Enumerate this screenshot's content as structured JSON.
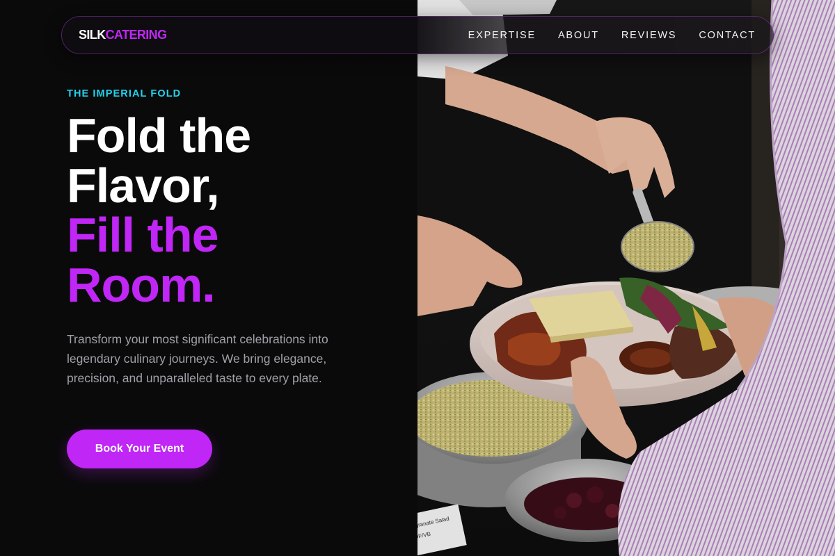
{
  "brand": {
    "part1": "SILK",
    "part2": "CATERING"
  },
  "nav": {
    "links": [
      {
        "label": "EXPERTISE"
      },
      {
        "label": "ABOUT"
      },
      {
        "label": "REVIEWS"
      },
      {
        "label": "CONTACT"
      }
    ]
  },
  "hero": {
    "eyebrow": "THE IMPERIAL FOLD",
    "headline_lines": [
      "Fold the",
      "Flavor,",
      "Fill the",
      "Room."
    ],
    "description": "Transform your most significant celebrations into legendary culinary journeys. We bring elegance, precision, and unparalleled taste to every plate.",
    "cta_label": "Book Your Event"
  },
  "image": {
    "card_text_line1": "egranate Salad",
    "card_text_line2": "DF/VB"
  },
  "colors": {
    "background": "#0a0a0b",
    "accent_purple": "#c026f5",
    "accent_cyan": "#22d3ee",
    "body_text": "#a0a1a8"
  }
}
